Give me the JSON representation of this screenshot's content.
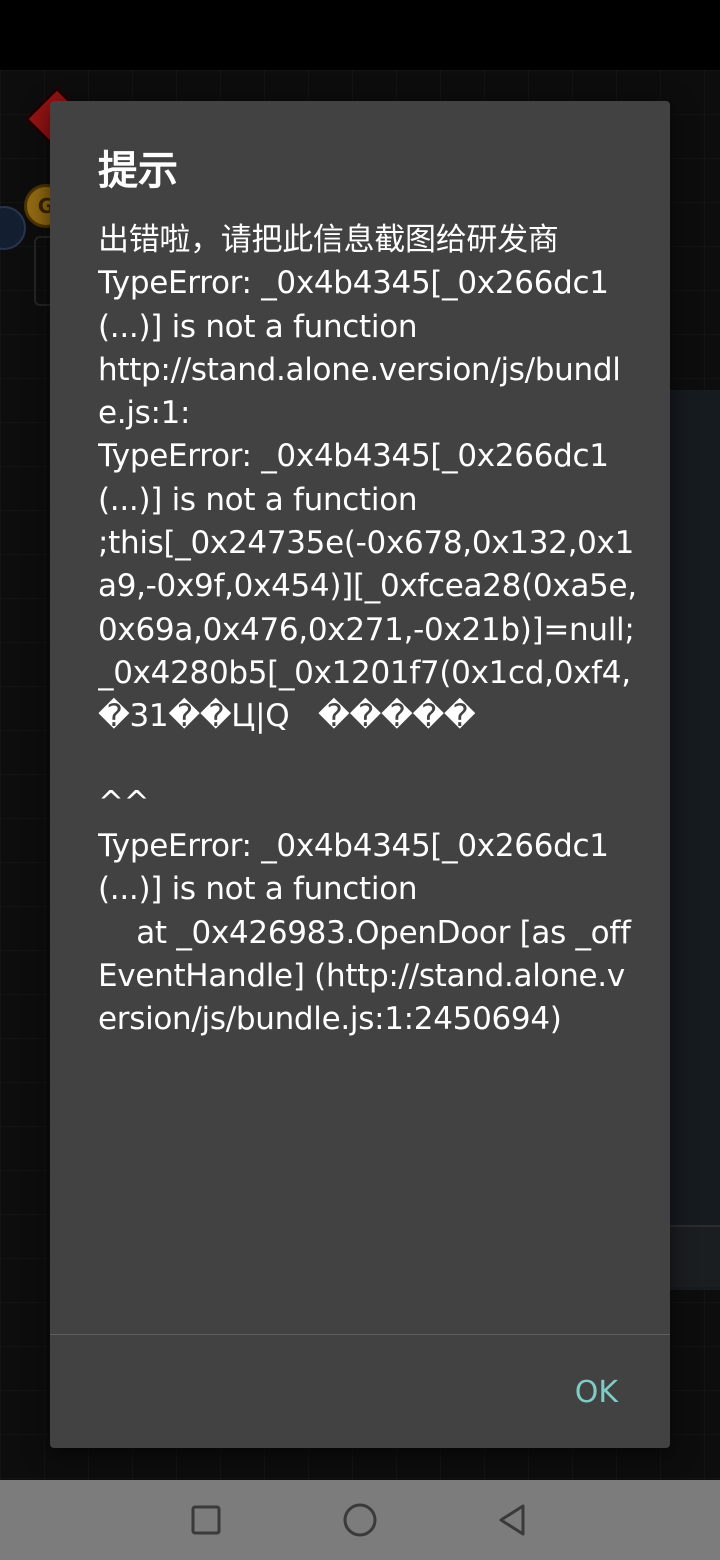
{
  "dialog": {
    "title": "提示",
    "message": "出错啦，请把此信息截图给研发商\nTypeError: _0x4b4345[_0x266dc1(...)] is not a function\nhttp://stand.alone.version/js/bundle.js:1:\nTypeError: _0x4b4345[_0x266dc1(...)] is not a function\n;this[_0x24735e(-0x678,0x132,0x1a9,-0x9f,0x454)][_0xfcea28(0xa5e,0x69a,0x476,0x271,-0x21b)]=null;_0x4280b5[_0x1201f7(0x1cd,0xf4,�31��Ц|Q   �����\n\n^^\nTypeError: _0x4b4345[_0x266dc1(...)] is not a function\n    at _0x426983.OpenDoor [as _offEventHandle] (http://stand.alone.version/js/bundle.js:1:2450694)",
    "ok_label": "OK"
  },
  "game": {
    "coin_label": "G"
  },
  "nav_bar": {
    "recents_icon": "square-icon",
    "home_icon": "circle-icon",
    "back_icon": "triangle-back-icon"
  },
  "colors": {
    "dialog_bg": "#424242",
    "accent": "#80cbc4",
    "nav_bar_bg": "#7c7c7c"
  }
}
